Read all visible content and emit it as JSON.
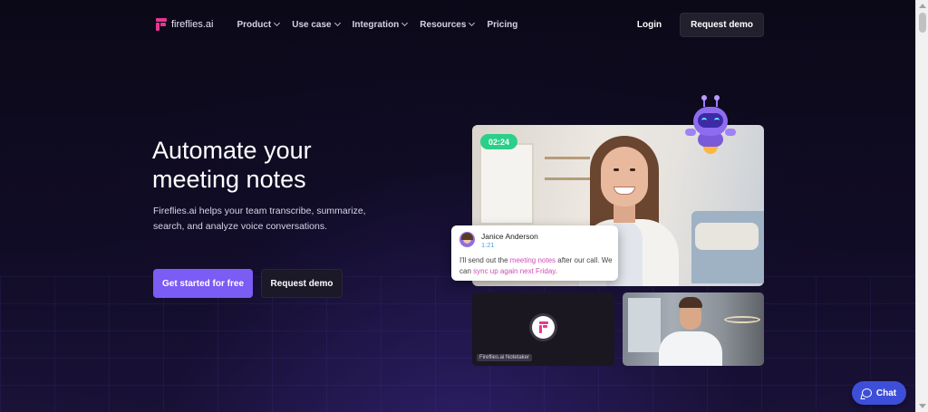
{
  "header": {
    "logo_text": "fireflies.ai",
    "menu": [
      {
        "label": "Product",
        "has_dropdown": true
      },
      {
        "label": "Use case",
        "has_dropdown": true
      },
      {
        "label": "Integration",
        "has_dropdown": true
      },
      {
        "label": "Resources",
        "has_dropdown": true
      },
      {
        "label": "Pricing",
        "has_dropdown": false
      }
    ],
    "login_label": "Login",
    "request_demo_label": "Request demo"
  },
  "hero": {
    "title_line1": "Automate your",
    "title_line2": "meeting notes",
    "subtitle": "Fireflies.ai helps your team transcribe, summarize, search, and analyze voice conversations.",
    "primary_cta": "Get started for free",
    "secondary_cta": "Request demo"
  },
  "demo": {
    "timer": "02:24",
    "chat": {
      "name": "Janice Anderson",
      "time": "1:21",
      "msg_part1": "I'll send out the ",
      "msg_hl1": "meeting notes",
      "msg_part2": " after our call. We can ",
      "msg_hl2": "sync up again next Friday",
      "msg_part3": "."
    },
    "notetaker_label": "Fireflies.ai Notetaker"
  },
  "chat_widget": {
    "label": "Chat"
  },
  "colors": {
    "accent": "#7b5cf5",
    "brand_pink": "#e8368f",
    "timer_green": "#2ad08a",
    "chat_widget": "#3d4fd8",
    "highlight": "#d24bb8"
  },
  "icons": [
    "fireflies-logo-icon",
    "chevron-down-icon",
    "robot-mascot-icon",
    "chat-bubble-icon"
  ]
}
